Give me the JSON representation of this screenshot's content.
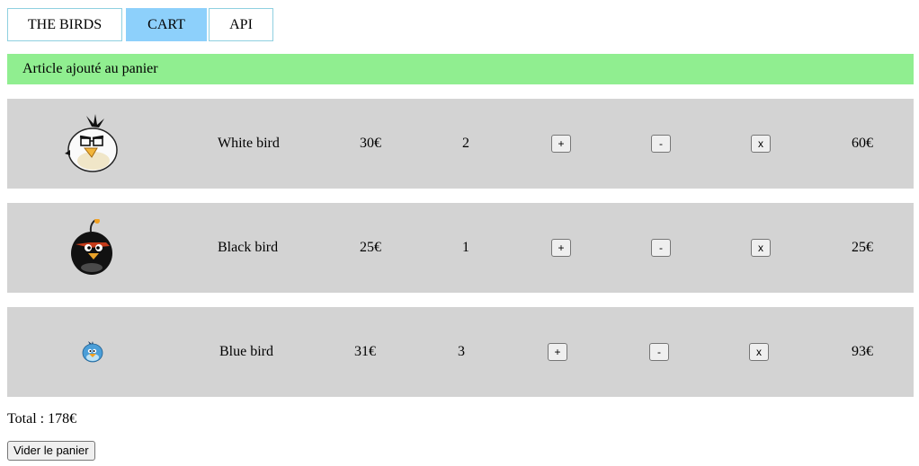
{
  "nav": {
    "items": [
      {
        "label": "THE BIRDS",
        "active": false
      },
      {
        "label": "CART",
        "active": true
      },
      {
        "label": "API",
        "active": false
      }
    ]
  },
  "banner": {
    "text": "Article ajouté au panier",
    "color": "#90ee90"
  },
  "cart": {
    "items": [
      {
        "icon": "white-bird-icon",
        "name": "White bird",
        "price": "30€",
        "quantity": "2",
        "plus": "+",
        "minus": "-",
        "remove": "x",
        "subtotal": "60€"
      },
      {
        "icon": "black-bird-icon",
        "name": "Black bird",
        "price": "25€",
        "quantity": "1",
        "plus": "+",
        "minus": "-",
        "remove": "x",
        "subtotal": "25€"
      },
      {
        "icon": "blue-bird-icon",
        "name": "Blue bird",
        "price": "31€",
        "quantity": "3",
        "plus": "+",
        "minus": "-",
        "remove": "x",
        "subtotal": "93€"
      }
    ]
  },
  "total": {
    "text": "Total : 178€"
  },
  "clear_button": {
    "label": "Vider le panier"
  },
  "colors": {
    "row_bg": "#d3d3d3",
    "active_tab": "#8dd0fb",
    "tab_border": "#8fd0e0"
  }
}
